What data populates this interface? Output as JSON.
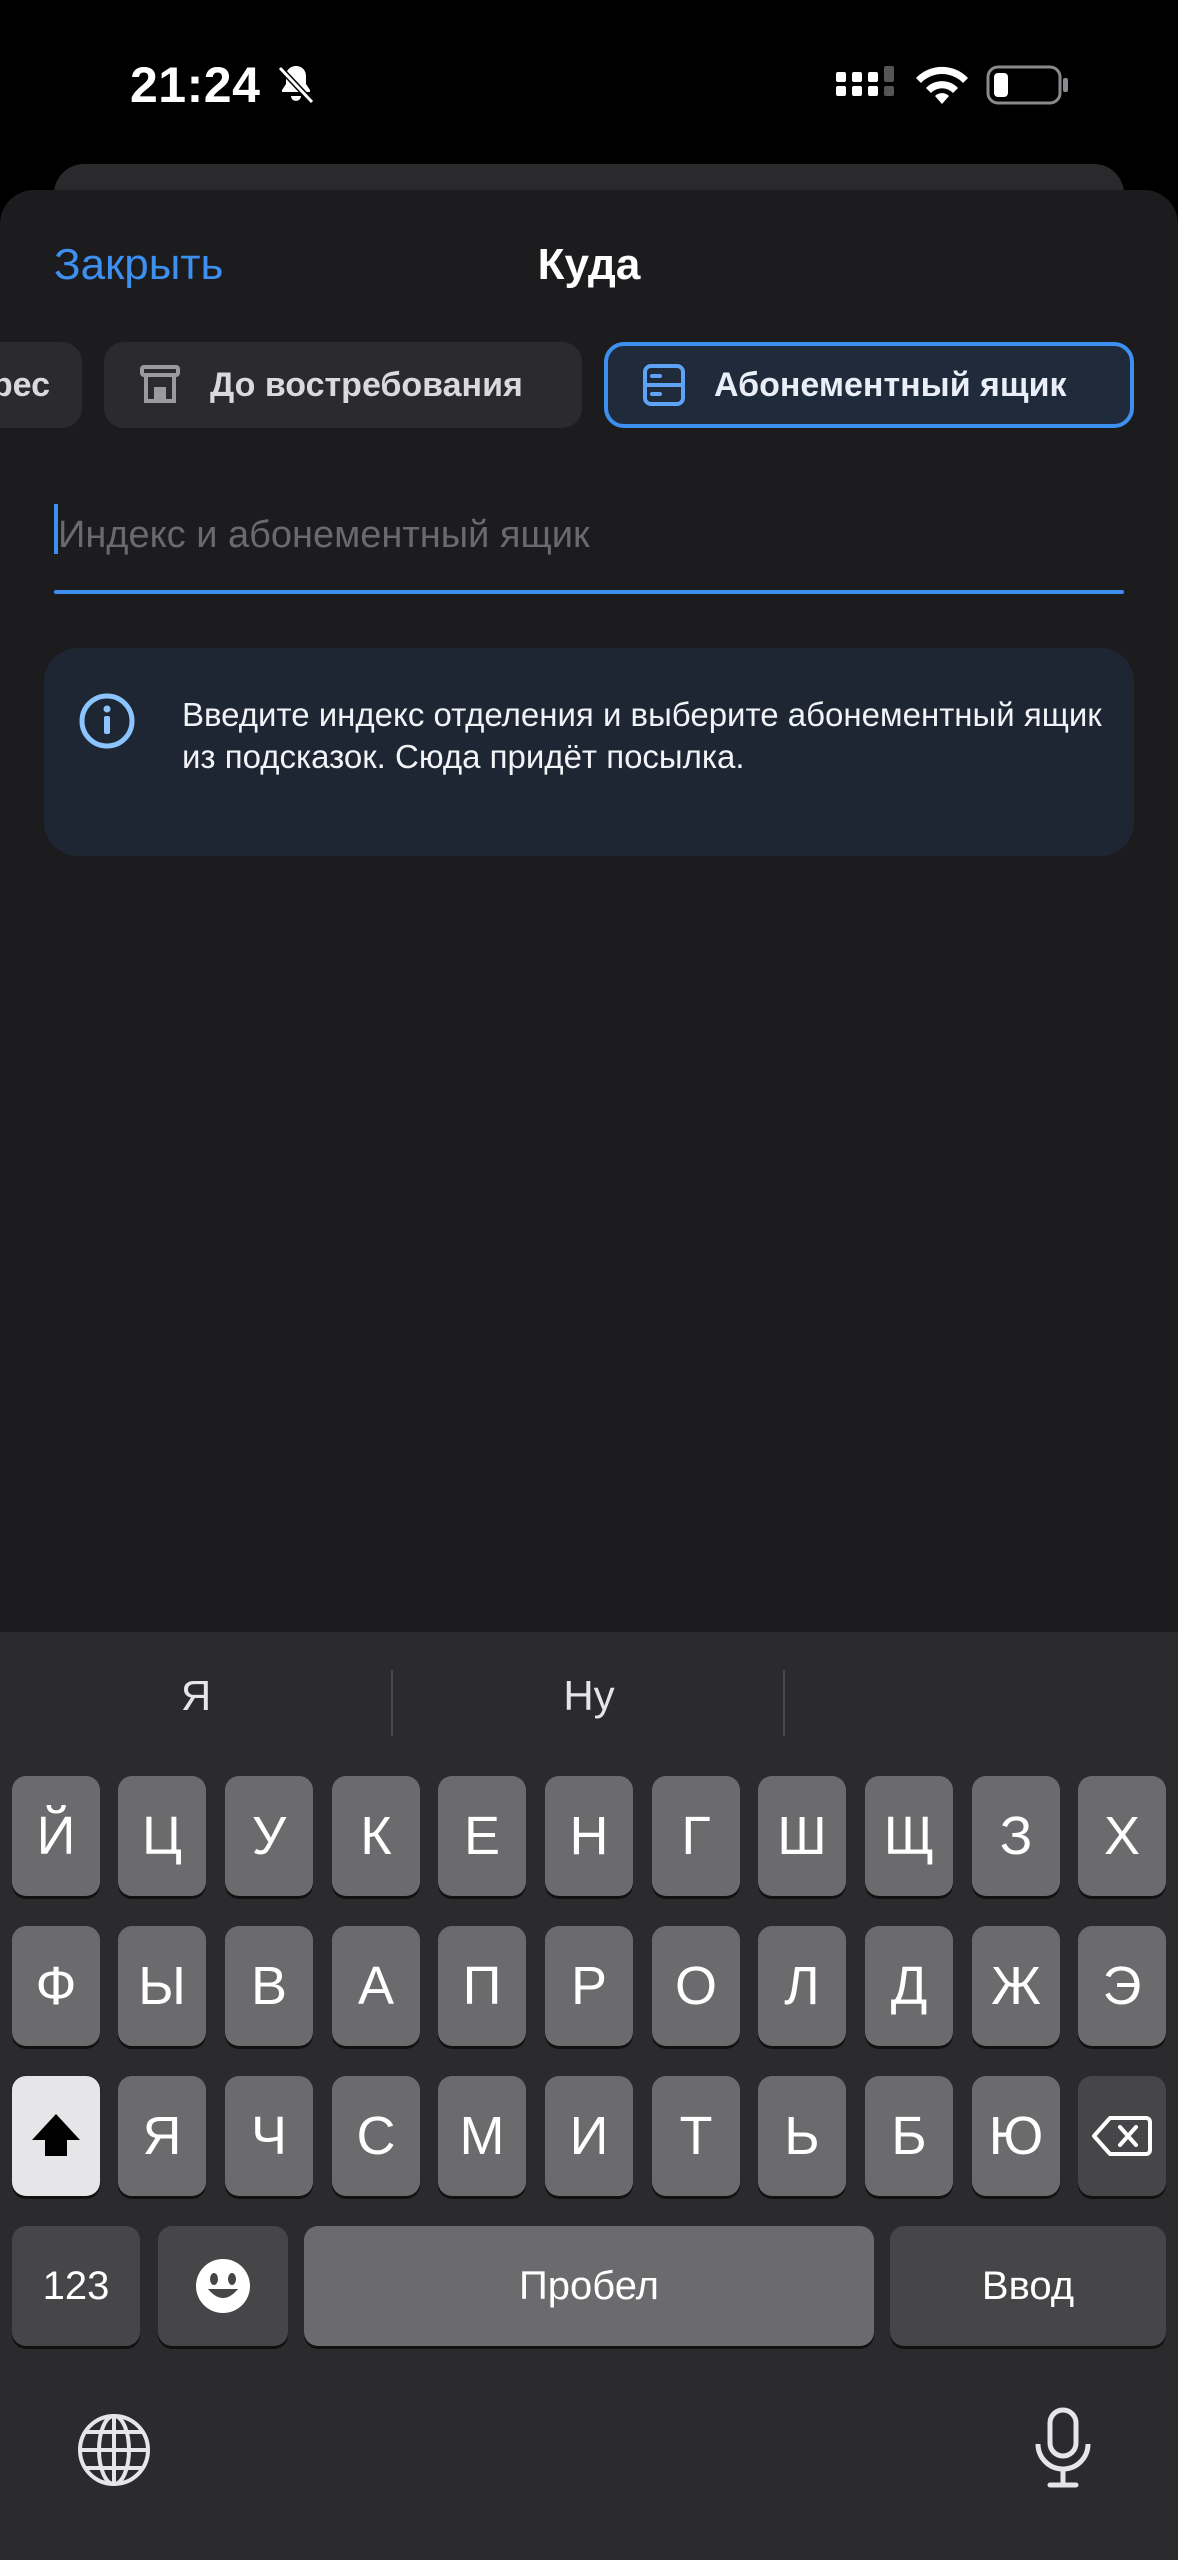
{
  "status_bar": {
    "time": "21:24",
    "icons": [
      "bell-slash-icon",
      "cellular-signal-icon",
      "wifi-icon",
      "battery-icon"
    ]
  },
  "header": {
    "close_label": "Закрыть",
    "title": "Куда"
  },
  "tabs": [
    {
      "label": "рес",
      "icon": "none"
    },
    {
      "label": "До востребования",
      "icon": "post-office-icon"
    },
    {
      "label": "Абонементный ящик",
      "icon": "po-box-icon",
      "selected": true
    }
  ],
  "input": {
    "placeholder": "Индекс и абонементный ящик",
    "value": ""
  },
  "info": {
    "icon": "info-icon",
    "text": "Введите индекс отделения и выберите абонементный ящик из подсказок. Сюда придёт посылка."
  },
  "keyboard": {
    "suggestions": [
      "Я",
      "Ну",
      ""
    ],
    "row1": [
      "Й",
      "Ц",
      "У",
      "К",
      "Е",
      "Н",
      "Г",
      "Ш",
      "Щ",
      "З",
      "Х"
    ],
    "row2": [
      "Ф",
      "Ы",
      "В",
      "А",
      "П",
      "Р",
      "О",
      "Л",
      "Д",
      "Ж",
      "Э"
    ],
    "row3": [
      "Я",
      "Ч",
      "С",
      "М",
      "И",
      "Т",
      "Ь",
      "Б",
      "Ю"
    ],
    "numbers_label": "123",
    "space_label": "Пробел",
    "return_label": "Ввод"
  },
  "colors": {
    "accent": "#3d8ff0",
    "sheet": "#1c1c1e",
    "keyboard": "#2b2b2d",
    "key": "#6b6b6e",
    "info_bg": "#1e2633"
  }
}
